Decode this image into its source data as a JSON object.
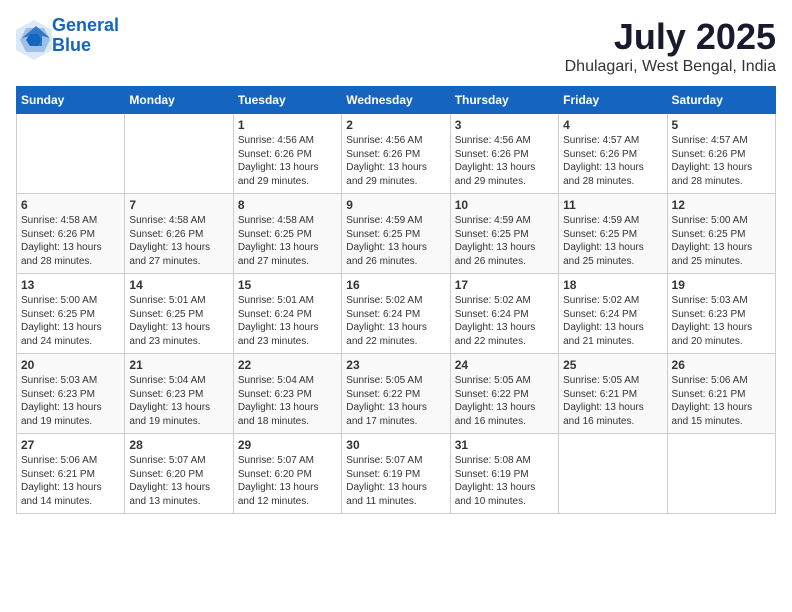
{
  "header": {
    "logo_line1": "General",
    "logo_line2": "Blue",
    "month_year": "July 2025",
    "location": "Dhulagari, West Bengal, India"
  },
  "weekdays": [
    "Sunday",
    "Monday",
    "Tuesday",
    "Wednesday",
    "Thursday",
    "Friday",
    "Saturday"
  ],
  "weeks": [
    [
      {
        "day": "",
        "sunrise": "",
        "sunset": "",
        "daylight": ""
      },
      {
        "day": "",
        "sunrise": "",
        "sunset": "",
        "daylight": ""
      },
      {
        "day": "1",
        "sunrise": "Sunrise: 4:56 AM",
        "sunset": "Sunset: 6:26 PM",
        "daylight": "Daylight: 13 hours and 29 minutes."
      },
      {
        "day": "2",
        "sunrise": "Sunrise: 4:56 AM",
        "sunset": "Sunset: 6:26 PM",
        "daylight": "Daylight: 13 hours and 29 minutes."
      },
      {
        "day": "3",
        "sunrise": "Sunrise: 4:56 AM",
        "sunset": "Sunset: 6:26 PM",
        "daylight": "Daylight: 13 hours and 29 minutes."
      },
      {
        "day": "4",
        "sunrise": "Sunrise: 4:57 AM",
        "sunset": "Sunset: 6:26 PM",
        "daylight": "Daylight: 13 hours and 28 minutes."
      },
      {
        "day": "5",
        "sunrise": "Sunrise: 4:57 AM",
        "sunset": "Sunset: 6:26 PM",
        "daylight": "Daylight: 13 hours and 28 minutes."
      }
    ],
    [
      {
        "day": "6",
        "sunrise": "Sunrise: 4:58 AM",
        "sunset": "Sunset: 6:26 PM",
        "daylight": "Daylight: 13 hours and 28 minutes."
      },
      {
        "day": "7",
        "sunrise": "Sunrise: 4:58 AM",
        "sunset": "Sunset: 6:26 PM",
        "daylight": "Daylight: 13 hours and 27 minutes."
      },
      {
        "day": "8",
        "sunrise": "Sunrise: 4:58 AM",
        "sunset": "Sunset: 6:25 PM",
        "daylight": "Daylight: 13 hours and 27 minutes."
      },
      {
        "day": "9",
        "sunrise": "Sunrise: 4:59 AM",
        "sunset": "Sunset: 6:25 PM",
        "daylight": "Daylight: 13 hours and 26 minutes."
      },
      {
        "day": "10",
        "sunrise": "Sunrise: 4:59 AM",
        "sunset": "Sunset: 6:25 PM",
        "daylight": "Daylight: 13 hours and 26 minutes."
      },
      {
        "day": "11",
        "sunrise": "Sunrise: 4:59 AM",
        "sunset": "Sunset: 6:25 PM",
        "daylight": "Daylight: 13 hours and 25 minutes."
      },
      {
        "day": "12",
        "sunrise": "Sunrise: 5:00 AM",
        "sunset": "Sunset: 6:25 PM",
        "daylight": "Daylight: 13 hours and 25 minutes."
      }
    ],
    [
      {
        "day": "13",
        "sunrise": "Sunrise: 5:00 AM",
        "sunset": "Sunset: 6:25 PM",
        "daylight": "Daylight: 13 hours and 24 minutes."
      },
      {
        "day": "14",
        "sunrise": "Sunrise: 5:01 AM",
        "sunset": "Sunset: 6:25 PM",
        "daylight": "Daylight: 13 hours and 23 minutes."
      },
      {
        "day": "15",
        "sunrise": "Sunrise: 5:01 AM",
        "sunset": "Sunset: 6:24 PM",
        "daylight": "Daylight: 13 hours and 23 minutes."
      },
      {
        "day": "16",
        "sunrise": "Sunrise: 5:02 AM",
        "sunset": "Sunset: 6:24 PM",
        "daylight": "Daylight: 13 hours and 22 minutes."
      },
      {
        "day": "17",
        "sunrise": "Sunrise: 5:02 AM",
        "sunset": "Sunset: 6:24 PM",
        "daylight": "Daylight: 13 hours and 22 minutes."
      },
      {
        "day": "18",
        "sunrise": "Sunrise: 5:02 AM",
        "sunset": "Sunset: 6:24 PM",
        "daylight": "Daylight: 13 hours and 21 minutes."
      },
      {
        "day": "19",
        "sunrise": "Sunrise: 5:03 AM",
        "sunset": "Sunset: 6:23 PM",
        "daylight": "Daylight: 13 hours and 20 minutes."
      }
    ],
    [
      {
        "day": "20",
        "sunrise": "Sunrise: 5:03 AM",
        "sunset": "Sunset: 6:23 PM",
        "daylight": "Daylight: 13 hours and 19 minutes."
      },
      {
        "day": "21",
        "sunrise": "Sunrise: 5:04 AM",
        "sunset": "Sunset: 6:23 PM",
        "daylight": "Daylight: 13 hours and 19 minutes."
      },
      {
        "day": "22",
        "sunrise": "Sunrise: 5:04 AM",
        "sunset": "Sunset: 6:23 PM",
        "daylight": "Daylight: 13 hours and 18 minutes."
      },
      {
        "day": "23",
        "sunrise": "Sunrise: 5:05 AM",
        "sunset": "Sunset: 6:22 PM",
        "daylight": "Daylight: 13 hours and 17 minutes."
      },
      {
        "day": "24",
        "sunrise": "Sunrise: 5:05 AM",
        "sunset": "Sunset: 6:22 PM",
        "daylight": "Daylight: 13 hours and 16 minutes."
      },
      {
        "day": "25",
        "sunrise": "Sunrise: 5:05 AM",
        "sunset": "Sunset: 6:21 PM",
        "daylight": "Daylight: 13 hours and 16 minutes."
      },
      {
        "day": "26",
        "sunrise": "Sunrise: 5:06 AM",
        "sunset": "Sunset: 6:21 PM",
        "daylight": "Daylight: 13 hours and 15 minutes."
      }
    ],
    [
      {
        "day": "27",
        "sunrise": "Sunrise: 5:06 AM",
        "sunset": "Sunset: 6:21 PM",
        "daylight": "Daylight: 13 hours and 14 minutes."
      },
      {
        "day": "28",
        "sunrise": "Sunrise: 5:07 AM",
        "sunset": "Sunset: 6:20 PM",
        "daylight": "Daylight: 13 hours and 13 minutes."
      },
      {
        "day": "29",
        "sunrise": "Sunrise: 5:07 AM",
        "sunset": "Sunset: 6:20 PM",
        "daylight": "Daylight: 13 hours and 12 minutes."
      },
      {
        "day": "30",
        "sunrise": "Sunrise: 5:07 AM",
        "sunset": "Sunset: 6:19 PM",
        "daylight": "Daylight: 13 hours and 11 minutes."
      },
      {
        "day": "31",
        "sunrise": "Sunrise: 5:08 AM",
        "sunset": "Sunset: 6:19 PM",
        "daylight": "Daylight: 13 hours and 10 minutes."
      },
      {
        "day": "",
        "sunrise": "",
        "sunset": "",
        "daylight": ""
      },
      {
        "day": "",
        "sunrise": "",
        "sunset": "",
        "daylight": ""
      }
    ]
  ]
}
